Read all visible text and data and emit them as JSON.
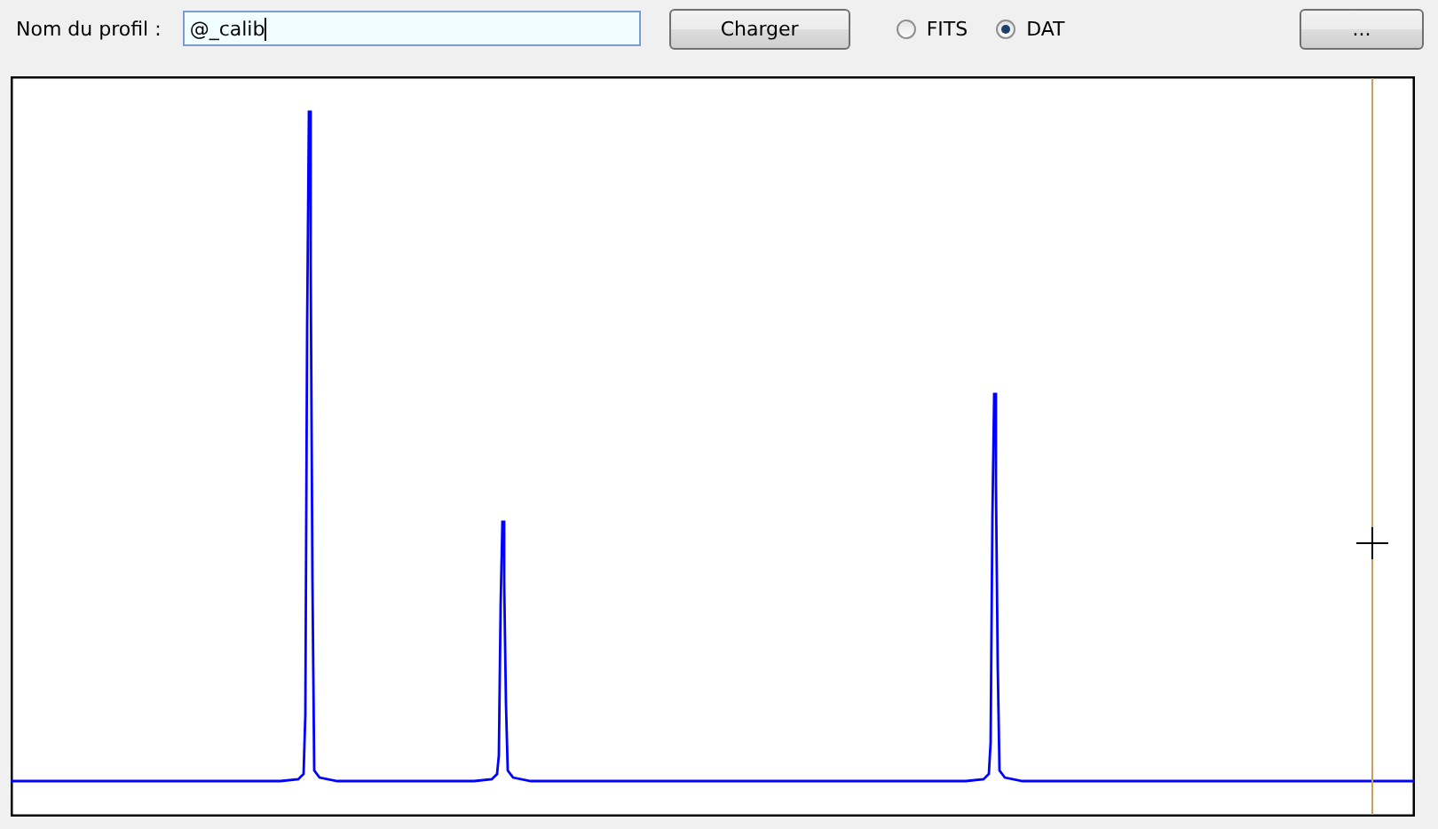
{
  "profile_field": {
    "label": "Nom du profil :",
    "value": "@_calib"
  },
  "load_button": "Charger",
  "format_options": [
    {
      "label": "FITS",
      "selected": false
    },
    {
      "label": "DAT",
      "selected": true
    }
  ],
  "more_button": "..."
}
